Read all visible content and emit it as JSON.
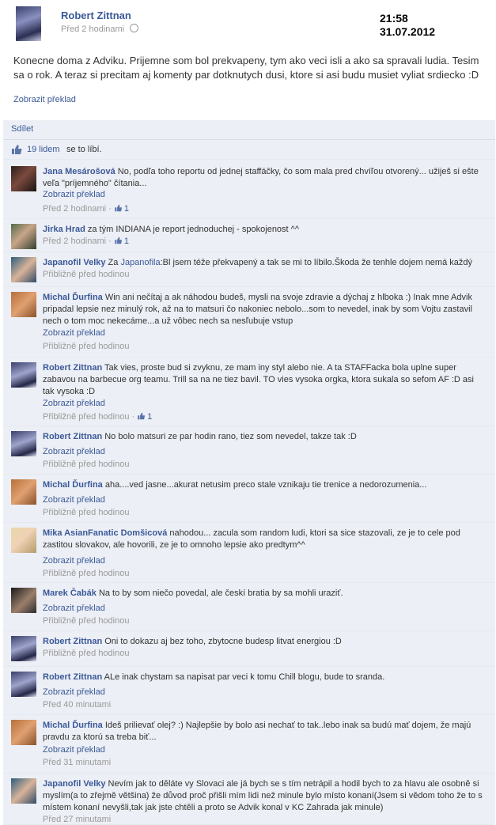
{
  "post": {
    "author": "Robert Zittnan",
    "time": "Před 2 hodinami",
    "clock_time": "21:58",
    "clock_date": "31.07.2012",
    "body": "Konecne doma z Adviku. Prijemne som bol prekvapeny, tym ako veci isli a ako sa spravali ludia. Tesim sa o rok. A teraz si precitam aj komenty par dotknutych dusi, ktore si asi budu musiet vyliat srdiecko :D",
    "translate": "Zobrazit překlad"
  },
  "feedback": {
    "share": "Sdílet",
    "likes_count": "19 lidem",
    "likes_text": "se to líbí."
  },
  "comments": [
    {
      "author": "Jana Mesárošová",
      "text": "No, podľa toho reportu od jednej staffáčky, čo som mala pred chvíľou otvorený... užiješ si ešte veľa \"príjemného\" čítania...",
      "translate": "Zobrazit překlad",
      "time": "Před 2 hodinami",
      "likes": "1"
    },
    {
      "author": "Jirka Hrad",
      "text": "za tým INDIANA je report jednoduchej - spokojenost ^^",
      "time": "Před 2 hodinami",
      "likes": "1"
    },
    {
      "author": "Japanofil Velky",
      "text_pre": "Za ",
      "link": "Japanofila",
      "text": ":Bl jsem téže překvapený a tak se mi to líbilo.Škoda že tenhle dojem nemá každý",
      "time": "Přibližně před hodinou"
    },
    {
      "author": "Michal Ďurfina",
      "text": "Win ani nečítaj a ak náhodou budeš, mysli na svoje zdravie a dýchaj z hlboka :) Inak mne Advik pripadal lepsie nez minulý rok, až na to matsuri čo nakoniec nebolo...som to nevedel, inak by som Vojtu zastavil nech o tom moc nekecáme...a už vôbec nech sa nesľubuje vstup",
      "translate": "Zobrazit překlad",
      "time": "Přibližně před hodinou"
    },
    {
      "author": "Robert Zittnan",
      "text": "Tak vies, proste bud si zvyknu, ze mam iny styl alebo nie. A ta STAFFacka bola uplne super zabavou na barbecue org teamu. Trill sa na ne tiez bavil. TO vies vysoka orgka, ktora sukala so sefom AF :D asi tak vysoka :D",
      "translate": "Zobrazit překlad",
      "time": "Přibližně před hodinou",
      "likes": "1"
    },
    {
      "author": "Robert Zittnan",
      "text": "No bolo matsuri ze par hodin rano, tiez som nevedel, takze tak :D",
      "translate": "Zobrazit překlad",
      "time": "Přibližně před hodinou"
    },
    {
      "author": "Michal Ďurfina",
      "text": "aha....ved jasne...akurat netusim preco stale vznikaju tie trenice a nedorozumenia...",
      "translate": "Zobrazit překlad",
      "time": "Přibližně před hodinou"
    },
    {
      "author": "Mika AsianFanatic Domšicová",
      "text": "nahodou... zacula som random ludi, ktori sa sice stazovali, ze je to cele pod zastitou slovakov, ale hovorili, ze je to omnoho lepsie ako predtym^^",
      "translate": "Zobrazit překlad",
      "time": "Přibližně před hodinou"
    },
    {
      "author": "Marek Čabák",
      "text": "Na to by som niečo povedal, ale českí bratia by sa mohli uraziť.",
      "translate": "Zobrazit překlad",
      "time": "Přibližně před hodinou"
    },
    {
      "author": "Robert Zittnan",
      "text": "Oni to dokazu aj bez toho, zbytocne budesp litvat energiou :D",
      "time": "Přibližně před hodinou"
    },
    {
      "author": "Robert Zittnan",
      "text": "ALe inak chystam sa napisat par veci k tomu Chill blogu, bude to sranda.",
      "translate": "Zobrazit překlad",
      "time": "Před 40 minutami"
    },
    {
      "author": "Michal Ďurfina",
      "text": "Ideš prilievať olej? :) Najlepšie by bolo asi nechať to tak..lebo inak sa budú mať dojem, že majú pravdu za ktorú sa treba biť...",
      "translate": "Zobrazit překlad",
      "time": "Před 31 minutami"
    },
    {
      "author": "Japanofil Velky",
      "text": "Nevím jak to děláte vy Slovaci ale já bych se s tím netrápil a hodil bych to za hlavu ale osobně si myslím(a to zřejmě většina) že důvod proč přišli mím lidi než minule bylo místo konaní(Jsem si vědom toho že to s místem konaní nevyšli,tak jak jste chtěli a proto se Advik konal v KC Zahrada jak minule)",
      "time": "Před 27 minutami"
    }
  ]
}
